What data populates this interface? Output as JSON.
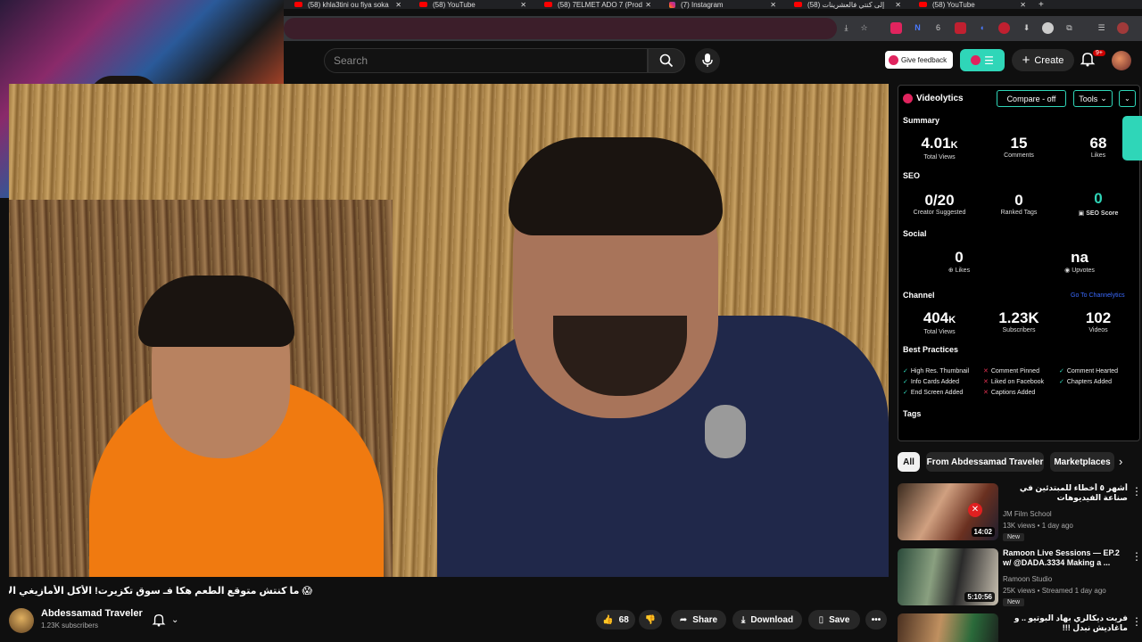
{
  "browser": {
    "tabs": [
      {
        "label": "(58) khla3tini ou fiya soka",
        "icon": "youtube-icon"
      },
      {
        "label": "(58) YouTube",
        "icon": "youtube-icon"
      },
      {
        "label": "(58) 7ELMET ADO 7 (Prod",
        "icon": "youtube-icon"
      },
      {
        "label": "(7) Instagram",
        "icon": "instagram-icon"
      },
      {
        "label": "(58) إلى كنتي فالعشرينات",
        "icon": "youtube-icon"
      },
      {
        "label": "(58) YouTube",
        "icon": "youtube-icon"
      }
    ],
    "ext_badge": "6"
  },
  "header": {
    "search_placeholder": "Search",
    "feedback_label": "Give feedback",
    "create_label": "Create",
    "notif_badge": "9+"
  },
  "video": {
    "title": "😱 ما كنتش متوقع الطعم هكا فـ سوق تكزيرت! الأكل الأمازيغي الأصلي 🔥",
    "channel": "Abdessamad Traveler",
    "subscribers": "1.23K subscribers",
    "likes": "68",
    "share_label": "Share",
    "download_label": "Download",
    "save_label": "Save"
  },
  "panel": {
    "brand": "Videolytics",
    "compare_label": "Compare - off",
    "tools_label": "Tools",
    "summary_title": "Summary",
    "summary": [
      {
        "value": "4.01",
        "suffix": "K",
        "label": "Total Views"
      },
      {
        "value": "15",
        "suffix": "",
        "label": "Comments"
      },
      {
        "value": "68",
        "suffix": "",
        "label": "Likes"
      }
    ],
    "seo_title": "SEO",
    "seo": [
      {
        "value": "0/20",
        "label": "Creator Suggested"
      },
      {
        "value": "0",
        "label": "Ranked Tags"
      },
      {
        "value": "0",
        "label": "SEO Score"
      }
    ],
    "social_title": "Social",
    "social": [
      {
        "value": "0",
        "label": "Likes"
      },
      {
        "value": "na",
        "label": "Upvotes"
      }
    ],
    "channel_title": "Channel",
    "channel_link": "Go To Channelytics",
    "channel": [
      {
        "value": "404",
        "suffix": "K",
        "label": "Total Views"
      },
      {
        "value": "1.23K",
        "suffix": "",
        "label": "Subscribers"
      },
      {
        "value": "102",
        "suffix": "",
        "label": "Videos"
      }
    ],
    "bp_title": "Best Practices",
    "best_practices": [
      {
        "label": "High Res. Thumbnail",
        "ok": true
      },
      {
        "label": "Comment Pinned",
        "ok": false
      },
      {
        "label": "Comment Hearted",
        "ok": true
      },
      {
        "label": "Info Cards Added",
        "ok": true
      },
      {
        "label": "Liked on Facebook",
        "ok": false
      },
      {
        "label": "Chapters Added",
        "ok": true
      },
      {
        "label": "End Screen Added",
        "ok": true
      },
      {
        "label": "Captions Added",
        "ok": false
      }
    ],
    "tags_title": "Tags"
  },
  "chips": [
    "All",
    "From Abdessamad Traveler",
    "Marketplaces"
  ],
  "recommendations": [
    {
      "title": "أشهر ٥ أخطاء للمبتدئين في صناعة الفيديوهات",
      "channel": "JM Film School",
      "meta": "13K views • 1 day ago",
      "duration": "14:02",
      "new": "New"
    },
    {
      "title": "Ramoon Live Sessions — EP.2 w/ @DADA.3334 Making a ...",
      "channel": "Ramoon Studio",
      "meta": "25K views • Streamed 1 day ago",
      "duration": "5:10:56",
      "new": "New"
    },
    {
      "title": "فريت ديكالري بهاد البوتيو .. و ماغاديش نبدل !!!",
      "channel": "",
      "meta": "",
      "duration": "",
      "new": ""
    }
  ],
  "colors": {
    "accent": "#2fd6b8",
    "youtube_red": "#ff0000",
    "bg": "#0f0f0f"
  }
}
